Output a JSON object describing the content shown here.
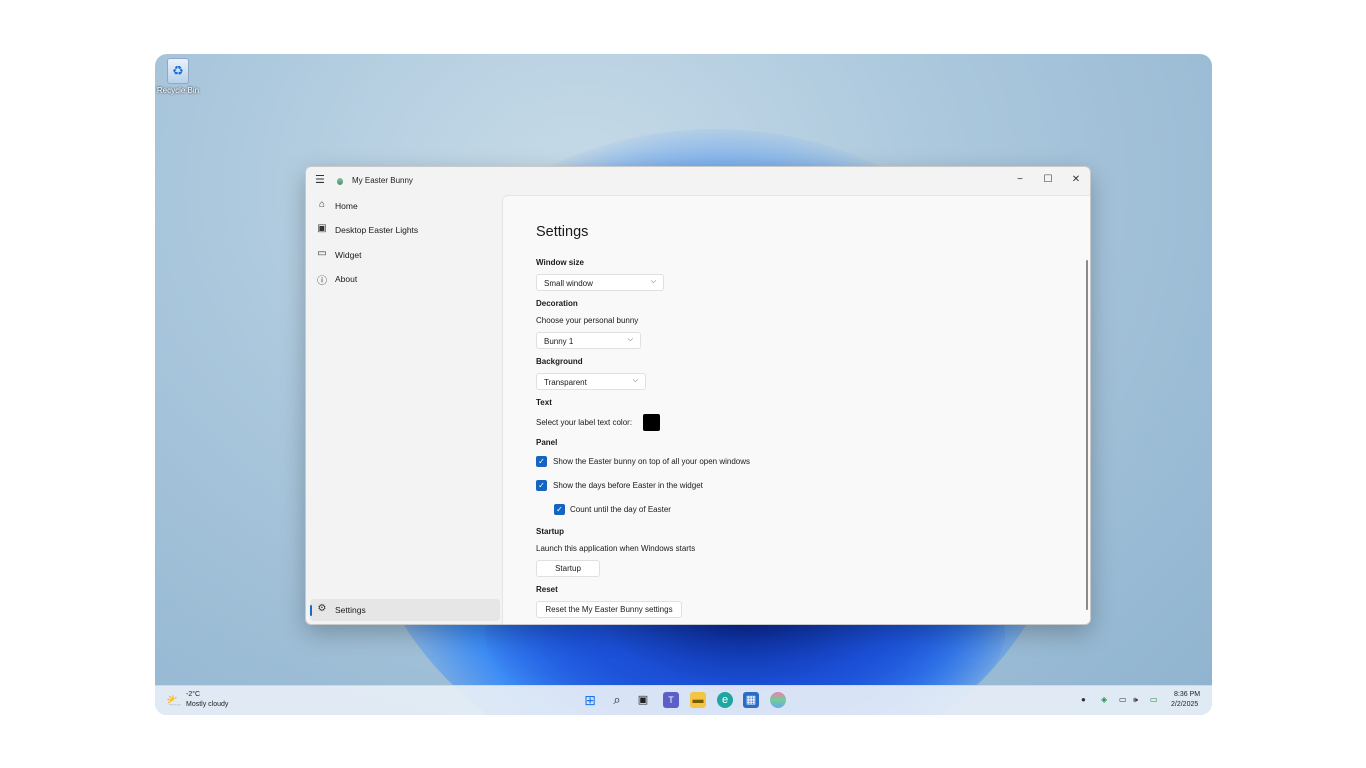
{
  "desktop": {
    "recycle_bin_label": "Recycle Bin"
  },
  "window": {
    "title": "My Easter Bunny",
    "controls": {
      "minimize": "−",
      "maximize": "☐",
      "close": "✕"
    }
  },
  "sidebar": {
    "menu_icon": "hamburger-icon",
    "items": [
      {
        "label": "Home",
        "icon": "home-icon"
      },
      {
        "label": "Desktop Easter Lights",
        "icon": "desktop-lights-icon"
      },
      {
        "label": "Widget",
        "icon": "widget-icon"
      },
      {
        "label": "About",
        "icon": "help-icon"
      }
    ],
    "footer_item": {
      "label": "Settings",
      "icon": "gear-icon",
      "selected": true
    }
  },
  "settings": {
    "title": "Settings",
    "window_size": {
      "heading": "Window size",
      "value": "Small window"
    },
    "decoration": {
      "heading": "Decoration",
      "description": "Choose your personal bunny",
      "value": "Bunny 1"
    },
    "background": {
      "heading": "Background",
      "value": "Transparent"
    },
    "text": {
      "heading": "Text",
      "label": "Select your label text color:",
      "color": "#000000"
    },
    "panel": {
      "heading": "Panel",
      "options": [
        {
          "label": "Show the Easter bunny on top of all your open windows",
          "checked": true
        },
        {
          "label": "Show the days before Easter in the widget",
          "checked": true
        },
        {
          "label": "Count until the day of Easter",
          "checked": true
        }
      ]
    },
    "startup": {
      "heading": "Startup",
      "description": "Launch this application when Windows starts",
      "button": "Startup"
    },
    "reset": {
      "heading": "Reset",
      "button": "Reset the My Easter Bunny settings"
    }
  },
  "taskbar": {
    "weather": {
      "temp": "-2°C",
      "condition": "Mostly cloudy"
    },
    "apps": [
      "start-icon",
      "search-icon",
      "task-view-icon",
      "teams-icon",
      "file-explorer-icon",
      "edge-icon",
      "store-icon",
      "easter-bunny-app-icon"
    ],
    "clock": {
      "time": "8:36 PM",
      "date": "2/2/2025"
    }
  },
  "colors": {
    "accent": "#1565c0",
    "window_bg": "#f3f3f3",
    "content_bg": "#f9f9f9"
  }
}
